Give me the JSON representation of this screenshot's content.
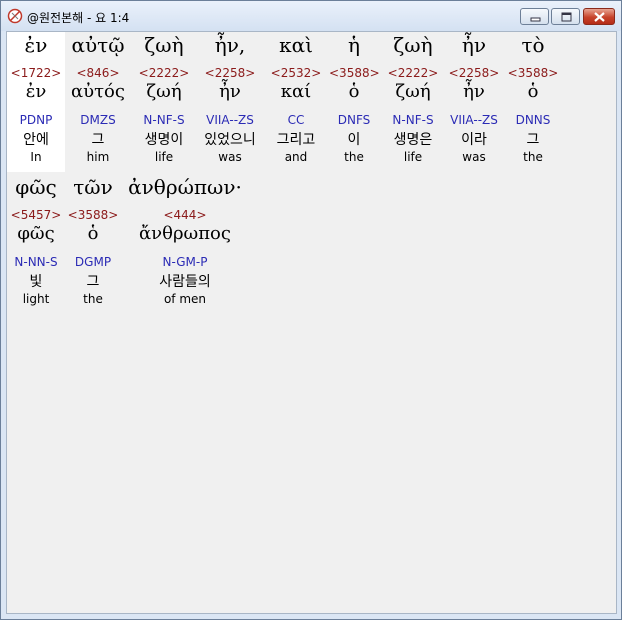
{
  "window": {
    "title": "@원전본해 - 요 1:4"
  },
  "words": [
    {
      "greek": "ἐν",
      "strong": "<1722>",
      "lemma": "ἐν",
      "parse": "PDNP",
      "korean": "안에",
      "english": "In"
    },
    {
      "greek": "αὐτῷ",
      "strong": "<846>",
      "lemma": "αὐτός",
      "parse": "DMZS",
      "korean": "그",
      "english": "him"
    },
    {
      "greek": "ζωὴ",
      "strong": "<2222>",
      "lemma": "ζωή",
      "parse": "N-NF-S",
      "korean": "생명이",
      "english": "life"
    },
    {
      "greek": "ἦν,",
      "strong": "<2258>",
      "lemma": "ἦν",
      "parse": "VIIA--ZS",
      "korean": "있었으니",
      "english": "was"
    },
    {
      "greek": "καὶ",
      "strong": "<2532>",
      "lemma": "καί",
      "parse": "CC",
      "korean": "그리고",
      "english": "and"
    },
    {
      "greek": "ἡ",
      "strong": "<3588>",
      "lemma": "ὁ",
      "parse": "DNFS",
      "korean": "이",
      "english": "the"
    },
    {
      "greek": "ζωὴ",
      "strong": "<2222>",
      "lemma": "ζωή",
      "parse": "N-NF-S",
      "korean": "생명은",
      "english": "life"
    },
    {
      "greek": "ἦν",
      "strong": "<2258>",
      "lemma": "ἦν",
      "parse": "VIIA--ZS",
      "korean": "이라",
      "english": "was"
    },
    {
      "greek": "τὸ",
      "strong": "<3588>",
      "lemma": "ὁ",
      "parse": "DNNS",
      "korean": "그",
      "english": "the"
    },
    {
      "greek": "φῶς",
      "strong": "<5457>",
      "lemma": "φῶς",
      "parse": "N-NN-S",
      "korean": "빛",
      "english": "light"
    },
    {
      "greek": "τῶν",
      "strong": "<3588>",
      "lemma": "ὁ",
      "parse": "DGMP",
      "korean": "그",
      "english": "the"
    },
    {
      "greek": "ἀνθρώπων·",
      "strong": "<444>",
      "lemma": "ἄνθρωπος",
      "parse": "N-GM-P",
      "korean": "사람들의",
      "english": "of men"
    }
  ]
}
